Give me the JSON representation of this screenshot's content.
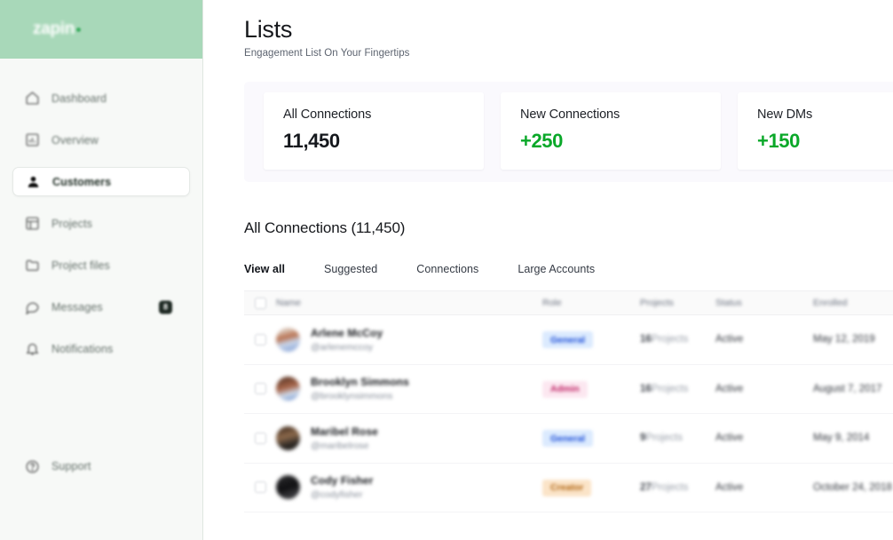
{
  "sidebar": {
    "brand": {
      "name": "zapin",
      "dot": "brand-dot"
    },
    "items": [
      {
        "label": "Dashboard",
        "icon": "home-icon",
        "active": false,
        "badge": ""
      },
      {
        "label": "Overview",
        "icon": "chart-icon",
        "active": false,
        "badge": ""
      },
      {
        "label": "Customers",
        "icon": "user-icon",
        "active": true,
        "badge": ""
      },
      {
        "label": "Projects",
        "icon": "grid-icon",
        "active": false,
        "badge": ""
      },
      {
        "label": "Project files",
        "icon": "folder-icon",
        "active": false,
        "badge": ""
      },
      {
        "label": "Messages",
        "icon": "chat-icon",
        "active": false,
        "badge": "8"
      },
      {
        "label": "Notifications",
        "icon": "bell-icon",
        "active": false,
        "badge": ""
      }
    ],
    "bottom": [
      {
        "label": "Support",
        "icon": "support-icon",
        "active": false,
        "badge": ""
      }
    ]
  },
  "header": {
    "title": "Lists",
    "subtitle": "Engagement List On Your Fingertips"
  },
  "stats": [
    {
      "label": "All Connections",
      "value": "11,450",
      "positive": false
    },
    {
      "label": "New Connections",
      "value": "+250",
      "positive": true
    },
    {
      "label": "New DMs",
      "value": "+150",
      "positive": true
    }
  ],
  "list": {
    "title": "All Connections (11,450)",
    "tabs": [
      {
        "label": "View all",
        "active": true
      },
      {
        "label": "Suggested",
        "active": false
      },
      {
        "label": "Connections",
        "active": false
      },
      {
        "label": "Large Accounts",
        "active": false
      }
    ],
    "columns": [
      "Name",
      "Role",
      "Projects",
      "Status",
      "Enrolled"
    ],
    "rows": [
      {
        "name": "Arlene McCoy",
        "handle": "@arlenemccoy",
        "role": "General",
        "role_color": "blue",
        "projects": "16",
        "projects_unit": "Projects",
        "status": "Active",
        "enrolled": "May 12, 2019",
        "avatar": "av1"
      },
      {
        "name": "Brooklyn Simmons",
        "handle": "@brooklynsimmons",
        "role": "Admin",
        "role_color": "pink",
        "projects": "16",
        "projects_unit": "Projects",
        "status": "Active",
        "enrolled": "August 7, 2017",
        "avatar": "av2"
      },
      {
        "name": "Maribel Rose",
        "handle": "@maribelrose",
        "role": "General",
        "role_color": "blue",
        "projects": "9",
        "projects_unit": "Projects",
        "status": "Active",
        "enrolled": "May 9, 2014",
        "avatar": "av3"
      },
      {
        "name": "Cody Fisher",
        "handle": "@codyfisher",
        "role": "Creator",
        "role_color": "orange",
        "projects": "27",
        "projects_unit": "Projects",
        "status": "Active",
        "enrolled": "October 24, 2018",
        "avatar": "av4"
      }
    ]
  },
  "colors": {
    "brand_green": "#a8d8b9",
    "accent_green": "#0aa829",
    "stats_panel": "#faf9fd",
    "sidebar_bg": "#f7f9f7",
    "badge_dark": "#1f2a24"
  }
}
